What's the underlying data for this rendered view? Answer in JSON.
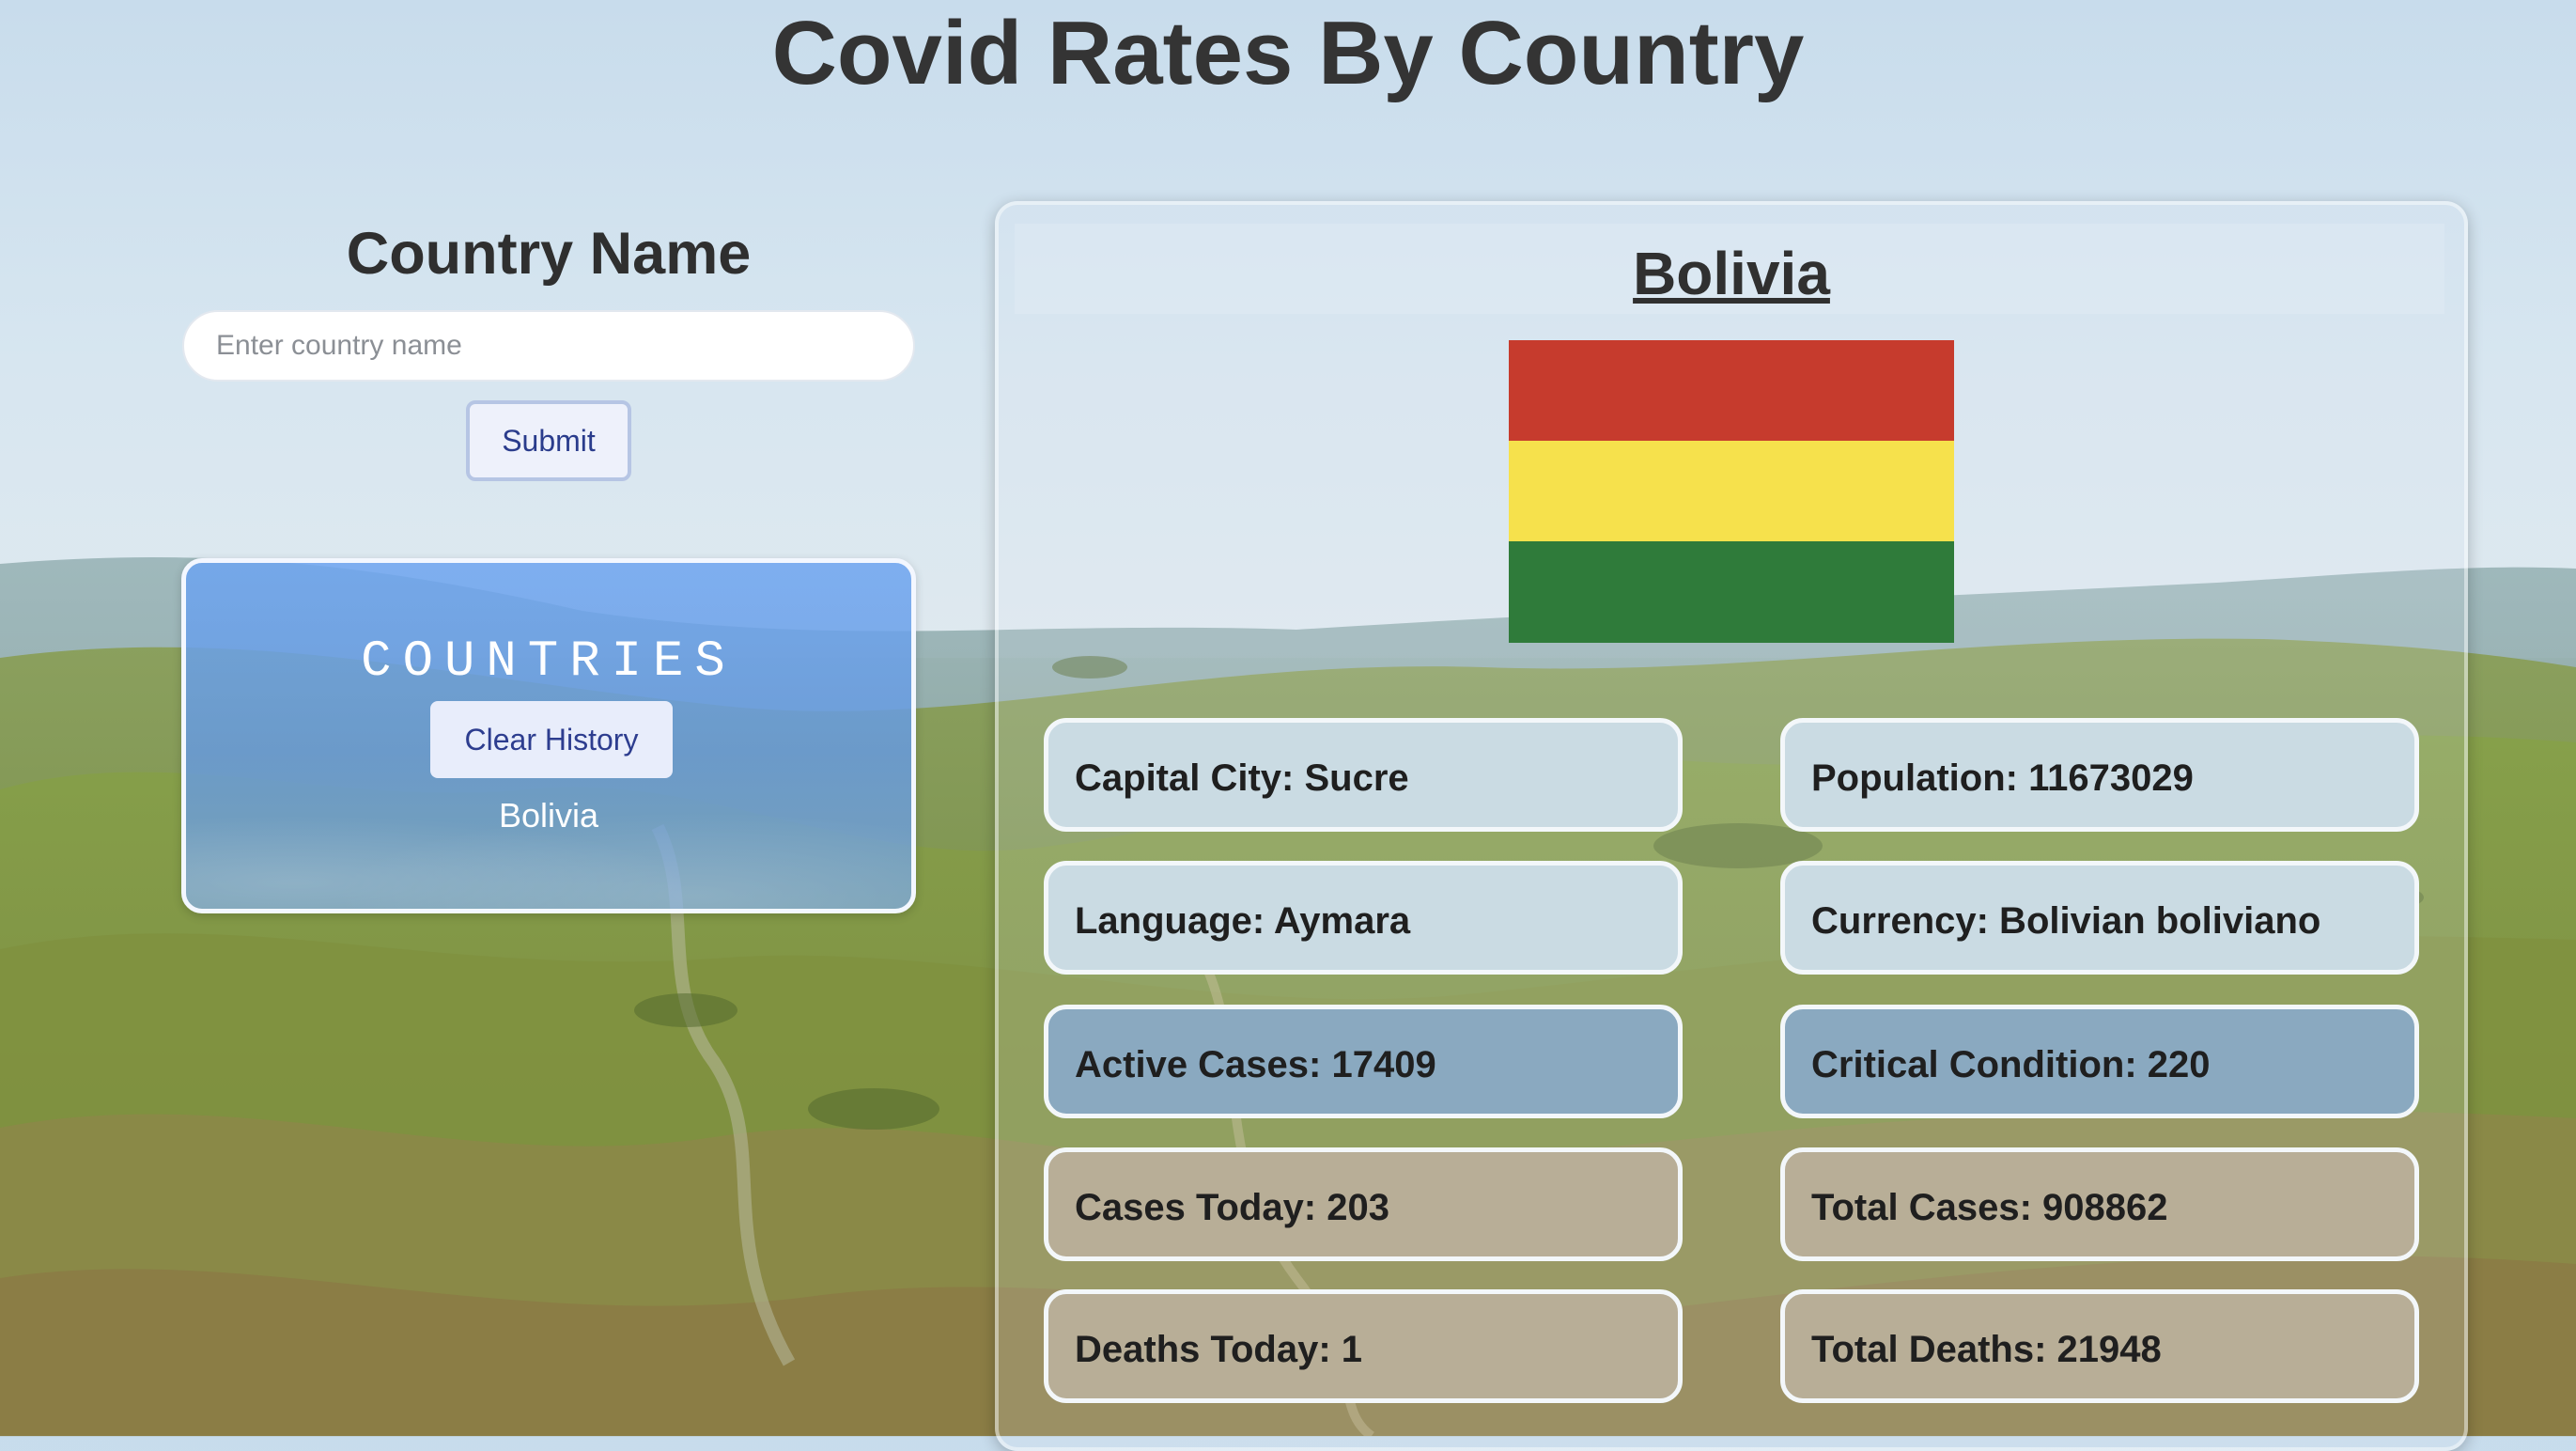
{
  "page": {
    "title": "Covid Rates By Country"
  },
  "search": {
    "label": "Country Name",
    "placeholder": "Enter country name",
    "submit_label": "Submit"
  },
  "history": {
    "title": "COUNTRIES",
    "clear_label": "Clear History",
    "items": [
      "Bolivia"
    ]
  },
  "country": {
    "name": "Bolivia",
    "flag": {
      "colors": [
        "#c63b2d",
        "#f6e14c",
        "#2f7b3a"
      ]
    },
    "stats": {
      "capital": "Capital City: Sucre",
      "population": "Population: 11673029",
      "language": "Language: Aymara",
      "currency": "Currency: Bolivian boliviano",
      "active_cases": "Active Cases: 17409",
      "critical_condition": "Critical Condition: 220",
      "cases_today": "Cases Today: 203",
      "total_cases": "Total Cases: 908862",
      "deaths_today": "Deaths Today: 1",
      "total_deaths": "Total Deaths: 21948"
    }
  },
  "colors": {
    "info_box": "#cadbe3",
    "covid_box": "#8aa9c0",
    "count_box": "#b8ae97",
    "history_panel": "#6ea5f0"
  }
}
